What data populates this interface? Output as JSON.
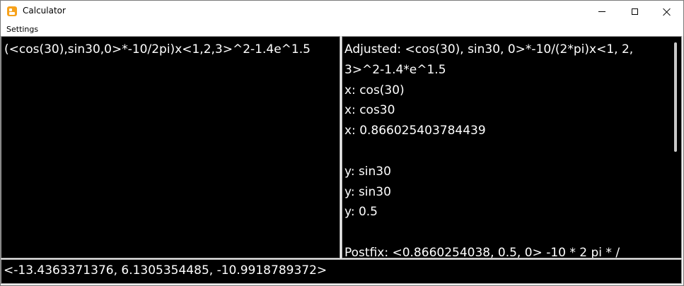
{
  "window": {
    "title": "Calculator"
  },
  "menu": {
    "settings_label": "Settings"
  },
  "input": {
    "expression": "(<cos(30),sin30,0>*-10/2pi)x<1,2,3>^2-1.4e^1.5"
  },
  "output": {
    "lines": [
      "Adjusted: <cos(30), sin30, 0>*-10/(2*pi)x<1, 2, 3>^2-1.4*e^1.5",
      "x: cos(30)",
      "x: cos30",
      "x: 0.866025403784439",
      "",
      "y: sin30",
      "y: sin30",
      "y: 0.5",
      "",
      "Postfix: <0.8660254038, 0.5, 0> -10 * 2 pi * /"
    ]
  },
  "result": {
    "value": "<-13.4363371376, 6.1305354485, -10.9918789372>"
  },
  "icons": {
    "app": "calculator-icon",
    "minimize": "minimize-icon",
    "maximize": "maximize-icon",
    "close": "close-icon"
  },
  "colors": {
    "pane_background": "#000000",
    "pane_text": "#ffffff",
    "app_icon": "#f7a21b"
  }
}
